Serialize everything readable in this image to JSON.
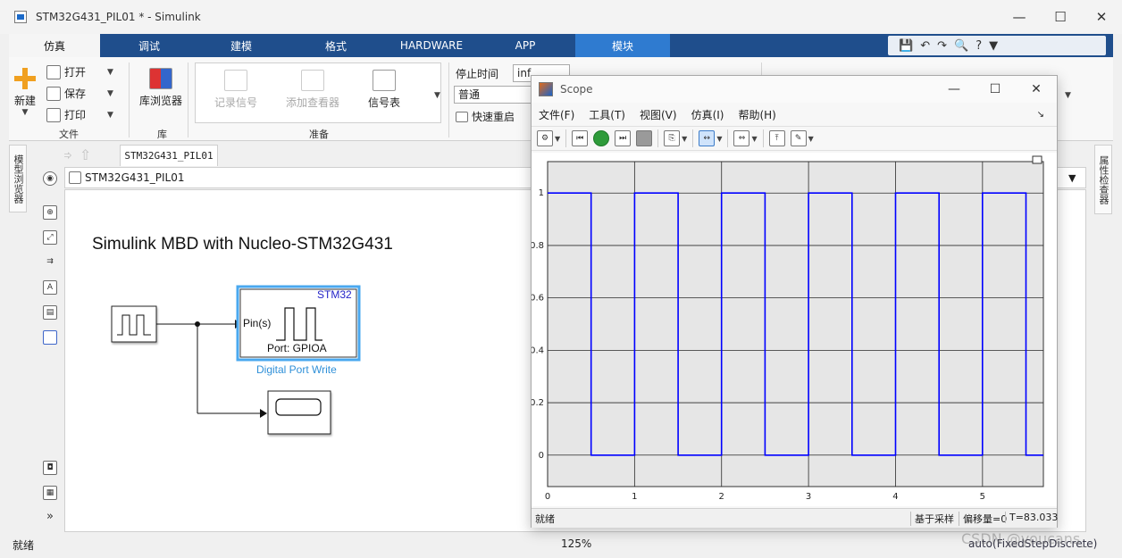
{
  "window": {
    "title": "STM32G431_PIL01 * - Simulink",
    "min": "—",
    "max": "☐",
    "close": "✕"
  },
  "menubar": {
    "tabs": [
      "仿真",
      "调试",
      "建模",
      "格式",
      "HARDWARE",
      "APP",
      "模块"
    ],
    "active_index": 0,
    "module_index": 6,
    "quick_icons": [
      "💾",
      "↶",
      "↷",
      "🔍",
      "?",
      "▼"
    ]
  },
  "ribbon": {
    "file": {
      "new": "新建",
      "open": "打开",
      "save": "保存",
      "print": "打印",
      "section": "文件"
    },
    "library": {
      "browser": "库浏览器",
      "section": "库"
    },
    "prepare": {
      "log_signals": "记录信号",
      "add_viewer": "添加查看器",
      "signal_table": "信号表",
      "section": "准备"
    },
    "simulate": {
      "stop_time_label": "停止时间",
      "stop_time_value": "inf",
      "mode_value": "普通",
      "fast_restart": "快速重启"
    }
  },
  "left": {
    "model_browser": "模型浏览器",
    "property_inspector": "属性检查器"
  },
  "editor": {
    "tab_label": "STM32G431_PIL01",
    "breadcrumb": "STM32G431_PIL01",
    "canvas_title": "Simulink MBD with Nucleo-STM32G431",
    "block_stm32": {
      "corner": "STM32",
      "port_in": "Pin(s)",
      "port": "Port: GPIOA",
      "name": "Digital Port Write"
    }
  },
  "status": {
    "left": "就绪",
    "zoom": "125%",
    "solver": "auto(FixedStepDiscrete)",
    "watermark": "CSDN @youcans_"
  },
  "scope": {
    "title": "Scope",
    "menu": [
      "文件(F)",
      "工具(T)",
      "视图(V)",
      "仿真(I)",
      "帮助(H)"
    ],
    "status": {
      "left": "就绪",
      "sample": "基于采样",
      "offset": "偏移量=0",
      "time": "T=83.033"
    },
    "colors": {
      "line": "#0000ff",
      "axes_bg": "#e6e6e6",
      "grid": "#2a2a2a"
    }
  },
  "chart_data": {
    "type": "line",
    "title": "",
    "xlabel": "",
    "ylabel": "",
    "xlim": [
      0,
      5.7
    ],
    "ylim": [
      -0.12,
      1.12
    ],
    "xticks": [
      0,
      1,
      2,
      3,
      4,
      5
    ],
    "yticks": [
      0,
      0.2,
      0.4,
      0.6,
      0.8,
      1
    ],
    "grid": true,
    "series": [
      {
        "name": "",
        "step": true,
        "x": [
          0,
          0.5,
          0.5,
          1,
          1,
          1.5,
          1.5,
          2,
          2,
          2.5,
          2.5,
          3,
          3,
          3.5,
          3.5,
          4,
          4,
          4.5,
          4.5,
          5,
          5,
          5.5,
          5.5,
          5.7
        ],
        "y": [
          1,
          1,
          0,
          0,
          1,
          1,
          0,
          0,
          1,
          1,
          0,
          0,
          1,
          1,
          0,
          0,
          1,
          1,
          0,
          0,
          1,
          1,
          0,
          0
        ]
      }
    ]
  }
}
